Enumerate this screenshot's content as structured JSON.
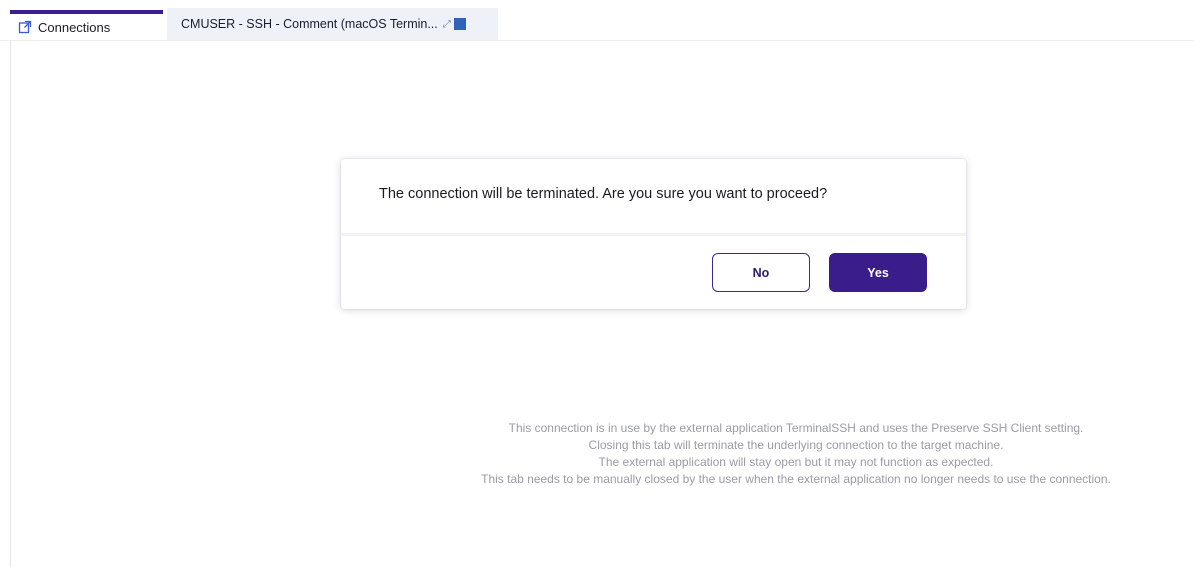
{
  "tabs": {
    "connections_label": "Connections",
    "session_label": "CMUSER - SSH - Comment (macOS Termin...",
    "session_status_icon": "external-link-icon"
  },
  "dialog": {
    "message": "The connection will be terminated. Are you sure you want to proceed?",
    "no_label": "No",
    "yes_label": "Yes"
  },
  "info": {
    "lines": [
      "This connection is in use by the external application TerminalSSH and uses the  Preserve SSH Client  setting.",
      "Closing this tab will terminate the underlying connection to the target machine.",
      "The external application will stay open but it may not function as expected.",
      "This tab needs to be manually closed by the user when the external application no longer needs to use the connection."
    ]
  },
  "colors": {
    "accent": "#3a1c8a",
    "active_tab_border": "#3f1d8f",
    "session_tab_bg": "#eef2f8",
    "info_text": "#9a9ca6"
  }
}
